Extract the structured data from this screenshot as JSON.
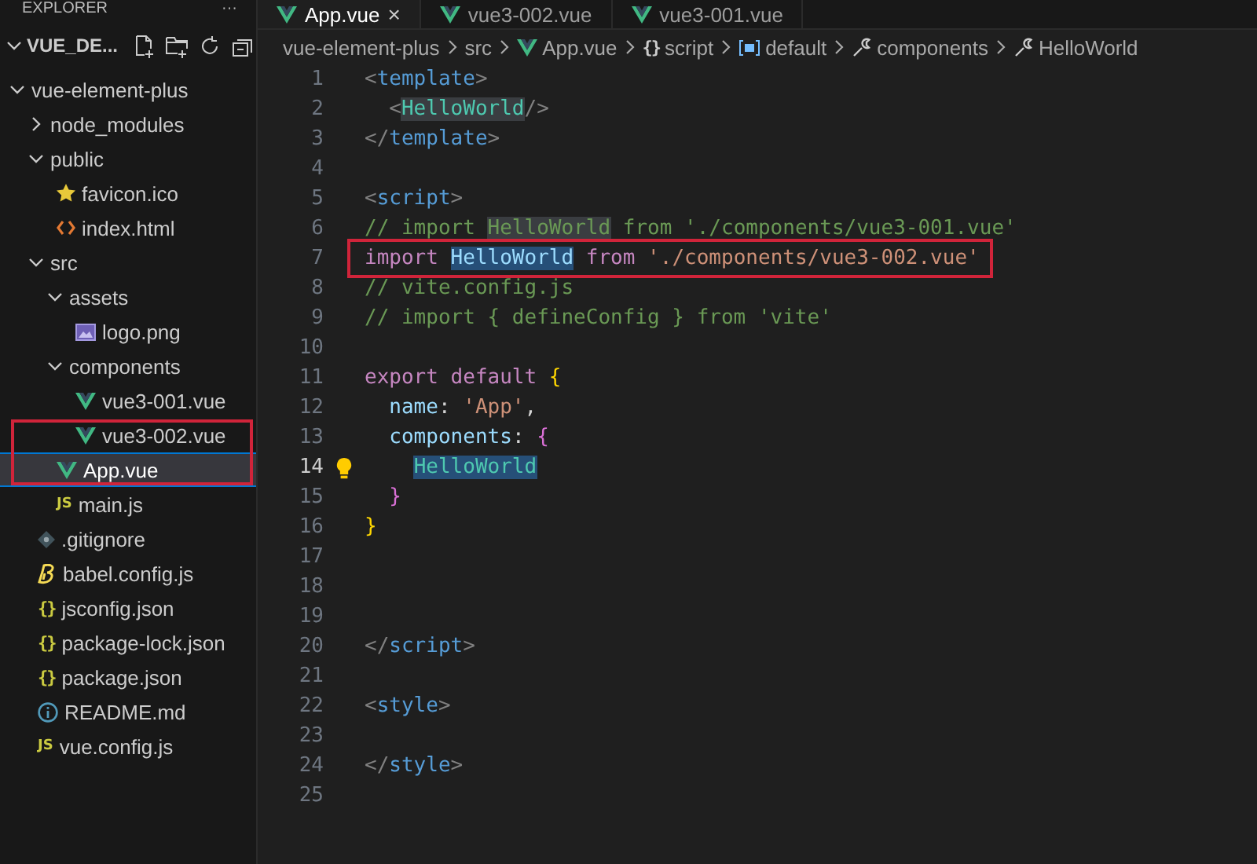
{
  "explorer": {
    "title": "EXPLORER",
    "more": "···",
    "root": "VUE_DE...",
    "tree": [
      {
        "name": "vue-element-plus",
        "kind": "folder",
        "expanded": true,
        "selected": false,
        "annotated": false,
        "children": [
          {
            "name": "node_modules",
            "kind": "folder",
            "expanded": false,
            "selected": false,
            "annotated": false
          },
          {
            "name": "public",
            "kind": "folder",
            "expanded": true,
            "selected": false,
            "annotated": false,
            "children": [
              {
                "name": "favicon.ico",
                "kind": "star",
                "selected": false,
                "annotated": false
              },
              {
                "name": "index.html",
                "kind": "html",
                "selected": false,
                "annotated": false
              }
            ]
          },
          {
            "name": "src",
            "kind": "folder",
            "expanded": true,
            "selected": false,
            "annotated": false,
            "children": [
              {
                "name": "assets",
                "kind": "folder",
                "expanded": true,
                "selected": false,
                "annotated": false,
                "children": [
                  {
                    "name": "logo.png",
                    "kind": "image",
                    "selected": false,
                    "annotated": false
                  }
                ]
              },
              {
                "name": "components",
                "kind": "folder",
                "expanded": true,
                "selected": false,
                "annotated": false,
                "children": [
                  {
                    "name": "vue3-001.vue",
                    "kind": "vue",
                    "selected": false,
                    "annotated": false
                  },
                  {
                    "name": "vue3-002.vue",
                    "kind": "vue",
                    "selected": false,
                    "annotated": true
                  }
                ]
              },
              {
                "name": "App.vue",
                "kind": "vue",
                "selected": true,
                "annotated": true
              },
              {
                "name": "main.js",
                "kind": "js",
                "icon_text": "JS",
                "selected": false,
                "annotated": false
              }
            ]
          },
          {
            "name": ".gitignore",
            "kind": "git",
            "selected": false,
            "annotated": false
          },
          {
            "name": "babel.config.js",
            "kind": "babel",
            "selected": false,
            "annotated": false
          },
          {
            "name": "jsconfig.json",
            "kind": "json",
            "icon_text": "{}",
            "selected": false,
            "annotated": false
          },
          {
            "name": "package-lock.json",
            "kind": "json",
            "icon_text": "{}",
            "selected": false,
            "annotated": false
          },
          {
            "name": "package.json",
            "kind": "json",
            "icon_text": "{}",
            "selected": false,
            "annotated": false
          },
          {
            "name": "README.md",
            "kind": "info",
            "selected": false,
            "annotated": false
          },
          {
            "name": "vue.config.js",
            "kind": "js",
            "icon_text": "JS",
            "selected": false,
            "annotated": false
          }
        ]
      }
    ]
  },
  "tabs": [
    {
      "label": "App.vue",
      "selected": true,
      "close": "×"
    },
    {
      "label": "vue3-002.vue",
      "selected": false
    },
    {
      "label": "vue3-001.vue",
      "selected": false
    }
  ],
  "breadcrumb": [
    {
      "label": "vue-element-plus",
      "kind": "folder"
    },
    {
      "label": "src",
      "kind": "folder"
    },
    {
      "label": "App.vue",
      "kind": "vue"
    },
    {
      "label": "script",
      "kind": "braces",
      "icon_text": "{}"
    },
    {
      "label": "default",
      "kind": "module"
    },
    {
      "label": "components",
      "kind": "wrench"
    },
    {
      "label": "HelloWorld",
      "kind": "wrench"
    }
  ],
  "code": [
    {
      "number": "1",
      "current": false,
      "lightbulb": false,
      "annotated": false,
      "tokens": [
        {
          "kind": "punct",
          "text": "<",
          "highlighted": false,
          "selected": false
        },
        {
          "kind": "tag",
          "text": "template",
          "highlighted": false,
          "selected": false
        },
        {
          "kind": "punct",
          "text": ">",
          "highlighted": false,
          "selected": false
        }
      ]
    },
    {
      "number": "2",
      "current": false,
      "lightbulb": false,
      "annotated": false,
      "tokens": [
        {
          "kind": "punct",
          "text": "  <",
          "highlighted": false,
          "selected": false
        },
        {
          "kind": "component",
          "text": "HelloWorld",
          "highlighted": true,
          "selected": false
        },
        {
          "kind": "punct",
          "text": "/>",
          "highlighted": false,
          "selected": false
        }
      ]
    },
    {
      "number": "3",
      "current": false,
      "lightbulb": false,
      "annotated": false,
      "tokens": [
        {
          "kind": "punct",
          "text": "</",
          "highlighted": false,
          "selected": false
        },
        {
          "kind": "tag",
          "text": "template",
          "highlighted": false,
          "selected": false
        },
        {
          "kind": "punct",
          "text": ">",
          "highlighted": false,
          "selected": false
        }
      ]
    },
    {
      "number": "4",
      "current": false,
      "lightbulb": false,
      "annotated": false
    },
    {
      "number": "5",
      "current": false,
      "lightbulb": false,
      "annotated": false,
      "tokens": [
        {
          "kind": "punct",
          "text": "<",
          "highlighted": false,
          "selected": false
        },
        {
          "kind": "tag",
          "text": "script",
          "highlighted": false,
          "selected": false
        },
        {
          "kind": "punct",
          "text": ">",
          "highlighted": false,
          "selected": false
        }
      ]
    },
    {
      "number": "6",
      "current": false,
      "lightbulb": false,
      "annotated": false,
      "tokens": [
        {
          "kind": "comment",
          "text": "// import",
          "highlighted": false,
          "selected": false
        },
        {
          "kind": "comment",
          "text": " HelloWorld",
          "highlighted": true,
          "selected": false
        },
        {
          "kind": "comment",
          "text": " from './components/vue3-001.vue'",
          "highlighted": false,
          "selected": false
        }
      ]
    },
    {
      "number": "7",
      "current": false,
      "lightbulb": false,
      "annotated": true,
      "tokens": [
        {
          "kind": "keyword",
          "text": "import",
          "highlighted": false,
          "selected": false
        },
        {
          "kind": "variable",
          "text": " HelloWorld",
          "highlighted": false,
          "selected": true
        },
        {
          "kind": "keyword",
          "text": " from",
          "highlighted": false,
          "selected": false
        },
        {
          "kind": "string",
          "text": " './components/vue3-002.vue'",
          "highlighted": false,
          "selected": false
        }
      ]
    },
    {
      "number": "8",
      "current": false,
      "lightbulb": false,
      "annotated": false,
      "tokens": [
        {
          "kind": "comment",
          "text": "// vite.config.js",
          "highlighted": false,
          "selected": false
        }
      ]
    },
    {
      "number": "9",
      "current": false,
      "lightbulb": false,
      "annotated": false,
      "tokens": [
        {
          "kind": "comment",
          "text": "// import { defineConfig } from 'vite'",
          "highlighted": false,
          "selected": false
        }
      ]
    },
    {
      "number": "10",
      "current": false,
      "lightbulb": false,
      "annotated": false
    },
    {
      "number": "11",
      "current": false,
      "lightbulb": false,
      "annotated": false,
      "tokens": [
        {
          "kind": "keyword",
          "text": "export",
          "highlighted": false,
          "selected": false
        },
        {
          "kind": "keyword",
          "text": " default",
          "highlighted": false,
          "selected": false
        },
        {
          "kind": "brace1",
          "text": " {",
          "highlighted": false,
          "selected": false
        }
      ]
    },
    {
      "number": "12",
      "current": false,
      "lightbulb": false,
      "annotated": false,
      "tokens": [
        {
          "kind": "property",
          "text": "  name",
          "highlighted": false,
          "selected": false
        },
        {
          "kind": "plain",
          "text": ":",
          "highlighted": false,
          "selected": false
        },
        {
          "kind": "string",
          "text": " 'App'",
          "highlighted": false,
          "selected": false
        },
        {
          "kind": "plain",
          "text": ",",
          "highlighted": false,
          "selected": false
        }
      ]
    },
    {
      "number": "13",
      "current": false,
      "lightbulb": false,
      "annotated": false,
      "tokens": [
        {
          "kind": "property",
          "text": "  components",
          "highlighted": false,
          "selected": false
        },
        {
          "kind": "plain",
          "text": ":",
          "highlighted": false,
          "selected": false
        },
        {
          "kind": "brace2",
          "text": " {",
          "highlighted": false,
          "selected": false
        }
      ]
    },
    {
      "number": "14",
      "current": true,
      "lightbulb": true,
      "annotated": false,
      "tokens": [
        {
          "kind": "component",
          "text": "    HelloWorld",
          "highlighted": false,
          "selected": true
        }
      ]
    },
    {
      "number": "15",
      "current": false,
      "lightbulb": false,
      "annotated": false,
      "tokens": [
        {
          "kind": "brace2",
          "text": "  }",
          "highlighted": false,
          "selected": false
        }
      ]
    },
    {
      "number": "16",
      "current": false,
      "lightbulb": false,
      "annotated": false,
      "tokens": [
        {
          "kind": "brace1",
          "text": "}",
          "highlighted": false,
          "selected": false
        }
      ]
    },
    {
      "number": "17",
      "current": false,
      "lightbulb": false,
      "annotated": false
    },
    {
      "number": "18",
      "current": false,
      "lightbulb": false,
      "annotated": false
    },
    {
      "number": "19",
      "current": false,
      "lightbulb": false,
      "annotated": false
    },
    {
      "number": "20",
      "current": false,
      "lightbulb": false,
      "annotated": false,
      "tokens": [
        {
          "kind": "punct",
          "text": "</",
          "highlighted": false,
          "selected": false
        },
        {
          "kind": "tag",
          "text": "script",
          "highlighted": false,
          "selected": false
        },
        {
          "kind": "punct",
          "text": ">",
          "highlighted": false,
          "selected": false
        }
      ]
    },
    {
      "number": "21",
      "current": false,
      "lightbulb": false,
      "annotated": false
    },
    {
      "number": "22",
      "current": false,
      "lightbulb": false,
      "annotated": false,
      "tokens": [
        {
          "kind": "punct",
          "text": "<",
          "highlighted": false,
          "selected": false
        },
        {
          "kind": "tag",
          "text": "style",
          "highlighted": false,
          "selected": false
        },
        {
          "kind": "punct",
          "text": ">",
          "highlighted": false,
          "selected": false
        }
      ]
    },
    {
      "number": "23",
      "current": false,
      "lightbulb": false,
      "annotated": false
    },
    {
      "number": "24",
      "current": false,
      "lightbulb": false,
      "annotated": false,
      "tokens": [
        {
          "kind": "punct",
          "text": "</",
          "highlighted": false,
          "selected": false
        },
        {
          "kind": "tag",
          "text": "style",
          "highlighted": false,
          "selected": false
        },
        {
          "kind": "punct",
          "text": ">",
          "highlighted": false,
          "selected": false
        }
      ]
    },
    {
      "number": "25",
      "current": false,
      "lightbulb": false,
      "annotated": false
    }
  ]
}
